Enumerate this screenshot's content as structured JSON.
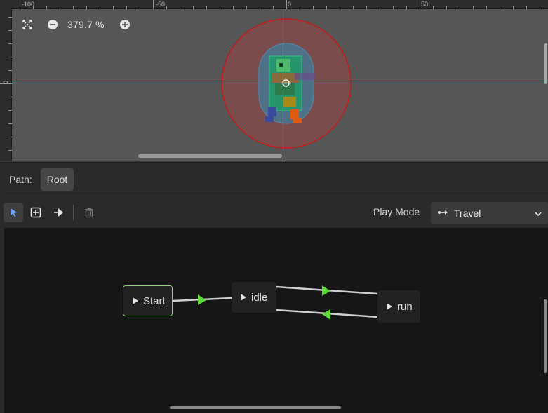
{
  "viewport": {
    "ruler_top_labels": [
      "-100",
      "-50",
      "0",
      "50"
    ],
    "ruler_left_labels": [
      "0"
    ],
    "zoom_text": "379.7 %",
    "icons": {
      "center": "center-view-icon",
      "zoom_out": "zoom-out-icon",
      "zoom_in": "zoom-in-icon"
    }
  },
  "path_bar": {
    "label": "Path:",
    "root_button": "Root"
  },
  "toolbar": {
    "tools": [
      "select-tool-icon",
      "add-node-tool-icon",
      "connect-tool-icon",
      "delete-icon"
    ],
    "play_mode_label": "Play Mode",
    "play_mode_value": "Travel",
    "play_mode_icon": "travel-icon"
  },
  "graph": {
    "nodes": [
      {
        "id": "start",
        "label": "Start"
      },
      {
        "id": "idle",
        "label": "idle"
      },
      {
        "id": "run",
        "label": "run"
      }
    ],
    "transitions": [
      {
        "from": "start",
        "to": "idle"
      },
      {
        "from": "idle",
        "to": "run"
      },
      {
        "from": "run",
        "to": "idle"
      }
    ],
    "colors": {
      "transition_arrow": "#5fd93a",
      "start_outline": "#8fd27a"
    }
  }
}
